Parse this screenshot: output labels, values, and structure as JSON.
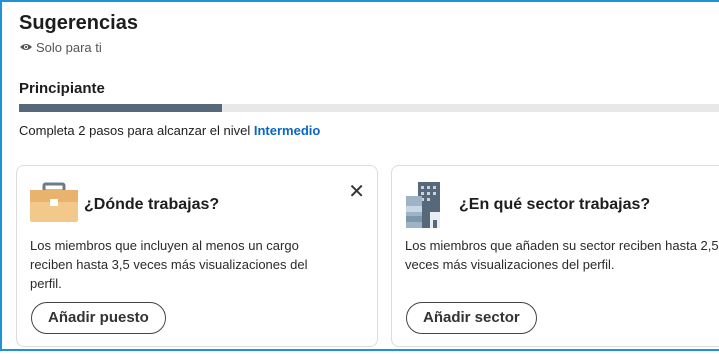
{
  "header": {
    "title": "Sugerencias",
    "privacy_label": "Solo para ti"
  },
  "progress": {
    "level_label": "Principiante",
    "fraction": 0.29,
    "hint_prefix": "Completa 2 pasos para alcanzar el nivel",
    "next_level": "Intermedio"
  },
  "cards": [
    {
      "icon": "briefcase-icon",
      "title": "¿Dónde trabajas?",
      "body": "Los miembros que incluyen al menos un cargo reciben hasta 3,5 veces más visualizaciones del perfil.",
      "button": "Añadir puesto",
      "close": "✕"
    },
    {
      "icon": "buildings-icon",
      "title": "¿En qué sector trabajas?",
      "body": "Los miembros que añaden su sector reciben hasta 2,5 veces más visualizaciones del perfil.",
      "button": "Añadir sector"
    }
  ],
  "colors": {
    "accent": "#0a66c2",
    "progress": "#56687a",
    "frame": "#1f93d8"
  }
}
